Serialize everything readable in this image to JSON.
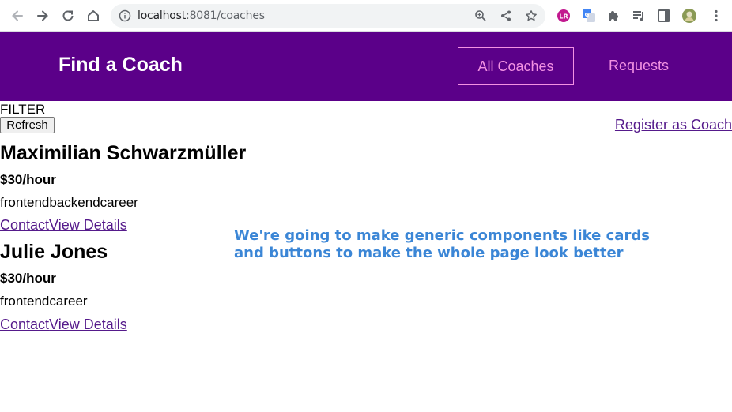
{
  "browser": {
    "url_host": "localhost",
    "url_path": ":8081/coaches"
  },
  "header": {
    "title": "Find a Coach",
    "nav": [
      {
        "label": "All Coaches",
        "active": true
      },
      {
        "label": "Requests",
        "active": false
      }
    ]
  },
  "controls": {
    "filter_label": "FILTER",
    "refresh_label": "Refresh",
    "register_label": "Register as Coach"
  },
  "coaches": [
    {
      "name": "Maximilian Schwarzmüller",
      "rate": "$30/hour",
      "areas": "frontendbackendcareer",
      "contact_label": "Contact",
      "details_label": "View Details"
    },
    {
      "name": "Julie Jones",
      "rate": "$30/hour",
      "areas": "frontendcareer",
      "contact_label": "Contact",
      "details_label": "View Details"
    }
  ],
  "annotation": {
    "line1": "We're going to make generic components like cards",
    "line2": "and buttons to make the whole page look better"
  },
  "colors": {
    "header_bg": "#5b0089",
    "nav_link": "#f391e3",
    "link": "#551a8b",
    "annotation": "#3b86d6"
  }
}
